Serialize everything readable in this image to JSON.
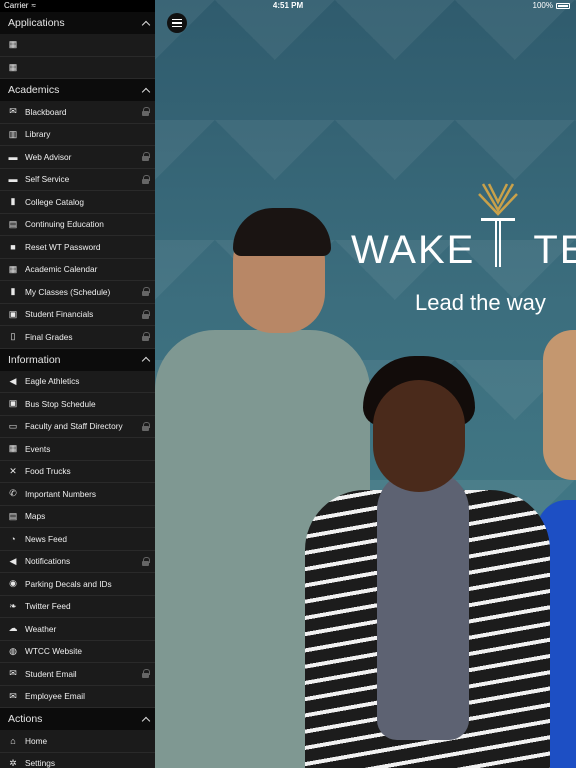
{
  "status_bar": {
    "carrier": "Carrier",
    "time": "4:51 PM",
    "battery": "100%"
  },
  "sidebar": {
    "sections": [
      {
        "title": "Applications",
        "items": [
          {
            "label": "",
            "icon": "calendar-icon",
            "locked": false
          },
          {
            "label": "",
            "icon": "calendar-icon",
            "locked": false
          }
        ]
      },
      {
        "title": "Academics",
        "items": [
          {
            "label": "Blackboard",
            "icon": "mail-icon",
            "locked": true
          },
          {
            "label": "Library",
            "icon": "book-icon",
            "locked": false
          },
          {
            "label": "Web Advisor",
            "icon": "chat-icon",
            "locked": true
          },
          {
            "label": "Self Service",
            "icon": "chat-icon",
            "locked": true
          },
          {
            "label": "College Catalog",
            "icon": "books-icon",
            "locked": false
          },
          {
            "label": "Continuing Education",
            "icon": "building-icon",
            "locked": false
          },
          {
            "label": "Reset WT Password",
            "icon": "lock-icon",
            "locked": false
          },
          {
            "label": "Academic Calendar",
            "icon": "calendar-icon",
            "locked": false
          },
          {
            "label": "My Classes (Schedule)",
            "icon": "bar-chart-icon",
            "locked": true
          },
          {
            "label": "Student Financials",
            "icon": "money-icon",
            "locked": true
          },
          {
            "label": "Final Grades",
            "icon": "document-icon",
            "locked": true
          }
        ]
      },
      {
        "title": "Information",
        "items": [
          {
            "label": "Eagle Athletics",
            "icon": "megaphone-icon",
            "locked": false
          },
          {
            "label": "Bus Stop Schedule",
            "icon": "bus-icon",
            "locked": false
          },
          {
            "label": "Faculty and Staff Directory",
            "icon": "id-card-icon",
            "locked": true
          },
          {
            "label": "Events",
            "icon": "calendar-grid-icon",
            "locked": false
          },
          {
            "label": "Food Trucks",
            "icon": "utensils-icon",
            "locked": false
          },
          {
            "label": "Important Numbers",
            "icon": "phone-icon",
            "locked": false
          },
          {
            "label": "Maps",
            "icon": "map-icon",
            "locked": false
          },
          {
            "label": "News Feed",
            "icon": "rss-icon",
            "locked": false
          },
          {
            "label": "Notifications",
            "icon": "speaker-icon",
            "locked": true
          },
          {
            "label": "Parking Decals and IDs",
            "icon": "parking-icon",
            "locked": false
          },
          {
            "label": "Twitter Feed",
            "icon": "twitter-icon",
            "locked": false
          },
          {
            "label": "Weather",
            "icon": "weather-icon",
            "locked": false
          },
          {
            "label": "WTCC Website",
            "icon": "globe-icon",
            "locked": false
          },
          {
            "label": "Student Email",
            "icon": "envelope-icon",
            "locked": true
          },
          {
            "label": "Employee Email",
            "icon": "envelope-icon",
            "locked": false
          }
        ]
      },
      {
        "title": "Actions",
        "items": [
          {
            "label": "Home",
            "icon": "home-icon",
            "locked": false
          },
          {
            "label": "Settings",
            "icon": "gear-icon",
            "locked": false
          }
        ]
      }
    ]
  },
  "hero": {
    "logo_text_left": "WAKE",
    "logo_text_right": "TE",
    "tagline": "Lead the way"
  },
  "colors": {
    "sidebar_bg": "#1b1b1b",
    "header_bg": "#0c0c0c",
    "hero_bg": "#3c6e7e"
  }
}
